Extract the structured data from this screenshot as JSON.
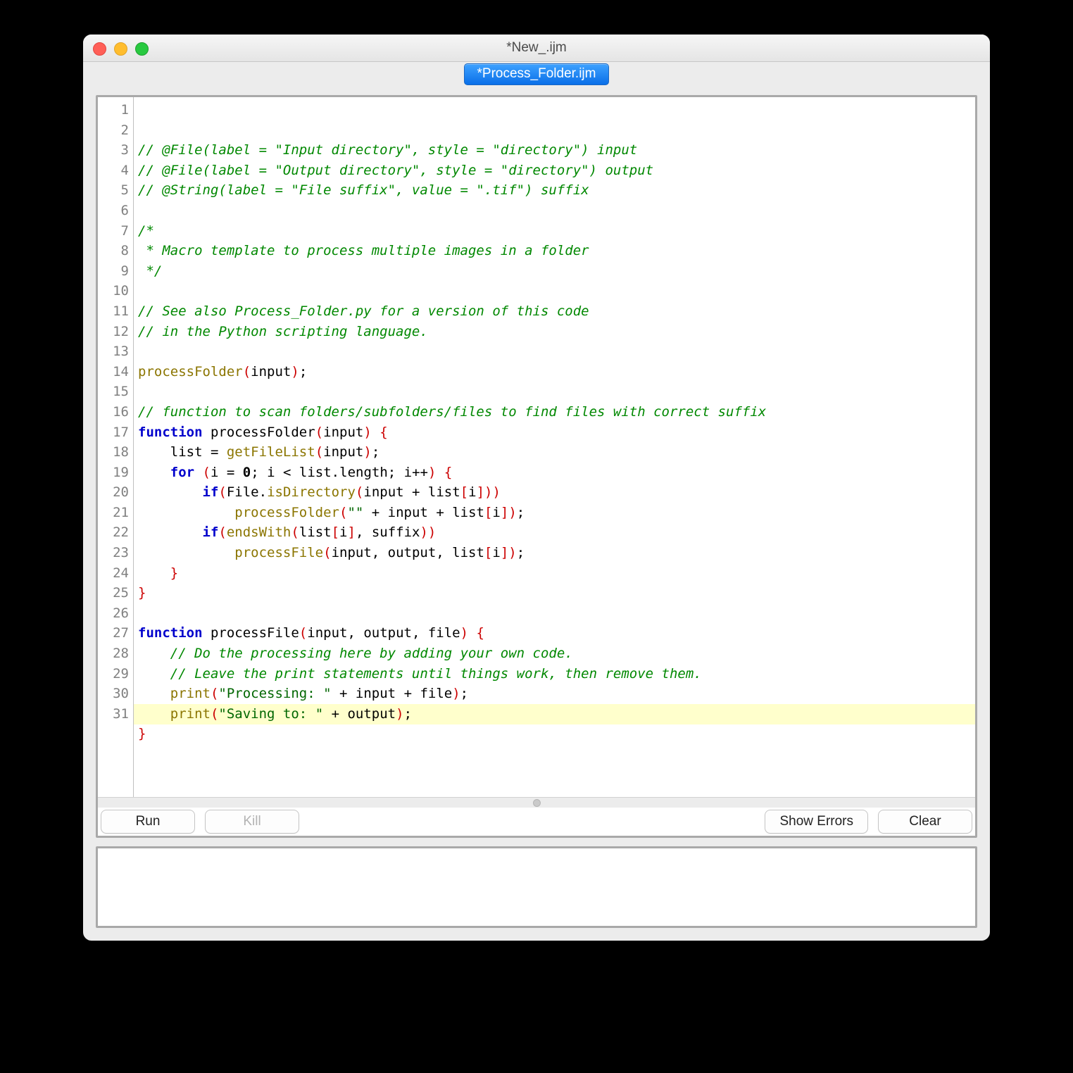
{
  "window": {
    "title": "*New_.ijm",
    "tab": "*Process_Folder.ijm"
  },
  "buttons": {
    "run": "Run",
    "kill": "Kill",
    "show_errors": "Show Errors",
    "clear": "Clear"
  },
  "editor": {
    "line_count": 31,
    "highlighted_line": 31,
    "lines": [
      {
        "n": 1,
        "tokens": [
          {
            "t": "// @File(label = \"Input directory\", style = \"directory\") input",
            "c": "c-comment"
          }
        ]
      },
      {
        "n": 2,
        "tokens": [
          {
            "t": "// @File(label = \"Output directory\", style = \"directory\") output",
            "c": "c-comment"
          }
        ]
      },
      {
        "n": 3,
        "tokens": [
          {
            "t": "// @String(label = \"File suffix\", value = \".tif\") suffix",
            "c": "c-comment"
          }
        ]
      },
      {
        "n": 4,
        "tokens": []
      },
      {
        "n": 5,
        "tokens": [
          {
            "t": "/*",
            "c": "c-comment"
          }
        ]
      },
      {
        "n": 6,
        "tokens": [
          {
            "t": " * Macro template to process multiple images in a folder",
            "c": "c-comment"
          }
        ]
      },
      {
        "n": 7,
        "tokens": [
          {
            "t": " */",
            "c": "c-comment"
          }
        ]
      },
      {
        "n": 8,
        "tokens": []
      },
      {
        "n": 9,
        "tokens": [
          {
            "t": "// See also Process_Folder.py for a version of this code",
            "c": "c-comment"
          }
        ]
      },
      {
        "n": 10,
        "tokens": [
          {
            "t": "// in the Python scripting language.",
            "c": "c-comment"
          }
        ]
      },
      {
        "n": 11,
        "tokens": []
      },
      {
        "n": 12,
        "tokens": [
          {
            "t": "processFolder",
            "c": "c-call"
          },
          {
            "t": "(",
            "c": "c-paren"
          },
          {
            "t": "input",
            "c": "c-var"
          },
          {
            "t": ")",
            "c": "c-paren"
          },
          {
            "t": ";",
            "c": "c-op"
          }
        ]
      },
      {
        "n": 13,
        "tokens": []
      },
      {
        "n": 14,
        "tokens": [
          {
            "t": "// function to scan folders/subfolders/files to find files with correct suffix",
            "c": "c-comment"
          }
        ]
      },
      {
        "n": 15,
        "tokens": [
          {
            "t": "function",
            "c": "c-kw"
          },
          {
            "t": " processFolder",
            "c": "c-fname"
          },
          {
            "t": "(",
            "c": "c-paren"
          },
          {
            "t": "input",
            "c": "c-var"
          },
          {
            "t": ")",
            "c": "c-paren"
          },
          {
            "t": " ",
            "c": "c-op"
          },
          {
            "t": "{",
            "c": "c-brace"
          }
        ]
      },
      {
        "n": 16,
        "tokens": [
          {
            "t": "    list ",
            "c": "c-var"
          },
          {
            "t": "=",
            "c": "c-op"
          },
          {
            "t": " ",
            "c": "c-op"
          },
          {
            "t": "getFileList",
            "c": "c-call"
          },
          {
            "t": "(",
            "c": "c-paren"
          },
          {
            "t": "input",
            "c": "c-var"
          },
          {
            "t": ")",
            "c": "c-paren"
          },
          {
            "t": ";",
            "c": "c-op"
          }
        ]
      },
      {
        "n": 17,
        "tokens": [
          {
            "t": "    ",
            "c": "c-op"
          },
          {
            "t": "for",
            "c": "c-kw"
          },
          {
            "t": " ",
            "c": "c-op"
          },
          {
            "t": "(",
            "c": "c-paren"
          },
          {
            "t": "i ",
            "c": "c-var"
          },
          {
            "t": "=",
            "c": "c-op"
          },
          {
            "t": " ",
            "c": "c-op"
          },
          {
            "t": "0",
            "c": "c-num"
          },
          {
            "t": "; i ",
            "c": "c-var"
          },
          {
            "t": "<",
            "c": "c-op"
          },
          {
            "t": " list",
            "c": "c-var"
          },
          {
            "t": ".",
            "c": "c-op"
          },
          {
            "t": "length; i",
            "c": "c-var"
          },
          {
            "t": "++",
            "c": "c-op"
          },
          {
            "t": ")",
            "c": "c-paren"
          },
          {
            "t": " ",
            "c": "c-op"
          },
          {
            "t": "{",
            "c": "c-brace"
          }
        ]
      },
      {
        "n": 18,
        "tokens": [
          {
            "t": "        ",
            "c": "c-op"
          },
          {
            "t": "if",
            "c": "c-kw"
          },
          {
            "t": "(",
            "c": "c-paren"
          },
          {
            "t": "File",
            "c": "c-var"
          },
          {
            "t": ".",
            "c": "c-op"
          },
          {
            "t": "isDirectory",
            "c": "c-call"
          },
          {
            "t": "(",
            "c": "c-paren"
          },
          {
            "t": "input ",
            "c": "c-var"
          },
          {
            "t": "+",
            "c": "c-op"
          },
          {
            "t": " list",
            "c": "c-var"
          },
          {
            "t": "[",
            "c": "c-paren"
          },
          {
            "t": "i",
            "c": "c-var"
          },
          {
            "t": "]",
            "c": "c-paren"
          },
          {
            "t": ")",
            "c": "c-paren"
          },
          {
            "t": ")",
            "c": "c-paren"
          }
        ]
      },
      {
        "n": 19,
        "tokens": [
          {
            "t": "            processFolder",
            "c": "c-call"
          },
          {
            "t": "(",
            "c": "c-paren"
          },
          {
            "t": "\"\"",
            "c": "c-str"
          },
          {
            "t": " ",
            "c": "c-op"
          },
          {
            "t": "+",
            "c": "c-op"
          },
          {
            "t": " input ",
            "c": "c-var"
          },
          {
            "t": "+",
            "c": "c-op"
          },
          {
            "t": " list",
            "c": "c-var"
          },
          {
            "t": "[",
            "c": "c-paren"
          },
          {
            "t": "i",
            "c": "c-var"
          },
          {
            "t": "]",
            "c": "c-paren"
          },
          {
            "t": ")",
            "c": "c-paren"
          },
          {
            "t": ";",
            "c": "c-op"
          }
        ]
      },
      {
        "n": 20,
        "tokens": [
          {
            "t": "        ",
            "c": "c-op"
          },
          {
            "t": "if",
            "c": "c-kw"
          },
          {
            "t": "(",
            "c": "c-paren"
          },
          {
            "t": "endsWith",
            "c": "c-call"
          },
          {
            "t": "(",
            "c": "c-paren"
          },
          {
            "t": "list",
            "c": "c-var"
          },
          {
            "t": "[",
            "c": "c-paren"
          },
          {
            "t": "i",
            "c": "c-var"
          },
          {
            "t": "]",
            "c": "c-paren"
          },
          {
            "t": ", suffix",
            "c": "c-var"
          },
          {
            "t": ")",
            "c": "c-paren"
          },
          {
            "t": ")",
            "c": "c-paren"
          }
        ]
      },
      {
        "n": 21,
        "tokens": [
          {
            "t": "            processFile",
            "c": "c-call"
          },
          {
            "t": "(",
            "c": "c-paren"
          },
          {
            "t": "input, output, list",
            "c": "c-var"
          },
          {
            "t": "[",
            "c": "c-paren"
          },
          {
            "t": "i",
            "c": "c-var"
          },
          {
            "t": "]",
            "c": "c-paren"
          },
          {
            "t": ")",
            "c": "c-paren"
          },
          {
            "t": ";",
            "c": "c-op"
          }
        ]
      },
      {
        "n": 22,
        "tokens": [
          {
            "t": "    ",
            "c": "c-op"
          },
          {
            "t": "}",
            "c": "c-brace"
          }
        ]
      },
      {
        "n": 23,
        "tokens": [
          {
            "t": "}",
            "c": "c-brace"
          }
        ]
      },
      {
        "n": 24,
        "tokens": []
      },
      {
        "n": 25,
        "tokens": [
          {
            "t": "function",
            "c": "c-kw"
          },
          {
            "t": " processFile",
            "c": "c-fname"
          },
          {
            "t": "(",
            "c": "c-paren"
          },
          {
            "t": "input, output, file",
            "c": "c-var"
          },
          {
            "t": ")",
            "c": "c-paren"
          },
          {
            "t": " ",
            "c": "c-op"
          },
          {
            "t": "{",
            "c": "c-brace"
          }
        ]
      },
      {
        "n": 26,
        "tokens": [
          {
            "t": "    ",
            "c": "c-op"
          },
          {
            "t": "// Do the processing here by adding your own code.",
            "c": "c-comment"
          }
        ]
      },
      {
        "n": 27,
        "tokens": [
          {
            "t": "    ",
            "c": "c-op"
          },
          {
            "t": "// Leave the print statements until things work, then remove them.",
            "c": "c-comment"
          }
        ]
      },
      {
        "n": 28,
        "tokens": [
          {
            "t": "    ",
            "c": "c-op"
          },
          {
            "t": "print",
            "c": "c-call"
          },
          {
            "t": "(",
            "c": "c-paren"
          },
          {
            "t": "\"Processing: \"",
            "c": "c-str"
          },
          {
            "t": " ",
            "c": "c-op"
          },
          {
            "t": "+",
            "c": "c-op"
          },
          {
            "t": " input ",
            "c": "c-var"
          },
          {
            "t": "+",
            "c": "c-op"
          },
          {
            "t": " file",
            "c": "c-var"
          },
          {
            "t": ")",
            "c": "c-paren"
          },
          {
            "t": ";",
            "c": "c-op"
          }
        ]
      },
      {
        "n": 29,
        "tokens": [
          {
            "t": "    ",
            "c": "c-op"
          },
          {
            "t": "print",
            "c": "c-call"
          },
          {
            "t": "(",
            "c": "c-paren"
          },
          {
            "t": "\"Saving to: \"",
            "c": "c-str"
          },
          {
            "t": " ",
            "c": "c-op"
          },
          {
            "t": "+",
            "c": "c-op"
          },
          {
            "t": " output",
            "c": "c-var"
          },
          {
            "t": ")",
            "c": "c-paren"
          },
          {
            "t": ";",
            "c": "c-op"
          }
        ]
      },
      {
        "n": 30,
        "tokens": [
          {
            "t": "}",
            "c": "c-brace"
          }
        ]
      },
      {
        "n": 31,
        "tokens": []
      }
    ]
  }
}
